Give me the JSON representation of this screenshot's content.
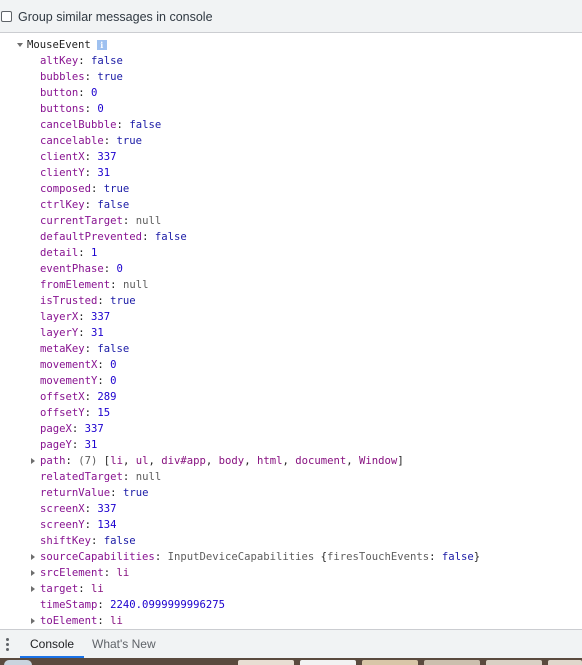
{
  "settings_bar": {
    "group_similar_label": "Group similar messages in console",
    "group_similar_checked": false
  },
  "console": {
    "object_name": "MouseEvent",
    "info_icon_glyph": "i",
    "properties": [
      {
        "key": "altKey",
        "value": "false",
        "kind": "bool",
        "expandable": false
      },
      {
        "key": "bubbles",
        "value": "true",
        "kind": "bool",
        "expandable": false
      },
      {
        "key": "button",
        "value": "0",
        "kind": "num",
        "expandable": false
      },
      {
        "key": "buttons",
        "value": "0",
        "kind": "num",
        "expandable": false
      },
      {
        "key": "cancelBubble",
        "value": "false",
        "kind": "bool",
        "expandable": false
      },
      {
        "key": "cancelable",
        "value": "true",
        "kind": "bool",
        "expandable": false
      },
      {
        "key": "clientX",
        "value": "337",
        "kind": "num",
        "expandable": false
      },
      {
        "key": "clientY",
        "value": "31",
        "kind": "num",
        "expandable": false
      },
      {
        "key": "composed",
        "value": "true",
        "kind": "bool",
        "expandable": false
      },
      {
        "key": "ctrlKey",
        "value": "false",
        "kind": "bool",
        "expandable": false
      },
      {
        "key": "currentTarget",
        "value": "null",
        "kind": "null",
        "expandable": false
      },
      {
        "key": "defaultPrevented",
        "value": "false",
        "kind": "bool",
        "expandable": false
      },
      {
        "key": "detail",
        "value": "1",
        "kind": "num",
        "expandable": false
      },
      {
        "key": "eventPhase",
        "value": "0",
        "kind": "num",
        "expandable": false
      },
      {
        "key": "fromElement",
        "value": "null",
        "kind": "null",
        "expandable": false
      },
      {
        "key": "isTrusted",
        "value": "true",
        "kind": "bool",
        "expandable": false
      },
      {
        "key": "layerX",
        "value": "337",
        "kind": "num",
        "expandable": false
      },
      {
        "key": "layerY",
        "value": "31",
        "kind": "num",
        "expandable": false
      },
      {
        "key": "metaKey",
        "value": "false",
        "kind": "bool",
        "expandable": false
      },
      {
        "key": "movementX",
        "value": "0",
        "kind": "num",
        "expandable": false
      },
      {
        "key": "movementY",
        "value": "0",
        "kind": "num",
        "expandable": false
      },
      {
        "key": "offsetX",
        "value": "289",
        "kind": "num",
        "expandable": false
      },
      {
        "key": "offsetY",
        "value": "15",
        "kind": "num",
        "expandable": false
      },
      {
        "key": "pageX",
        "value": "337",
        "kind": "num",
        "expandable": false
      },
      {
        "key": "pageY",
        "value": "31",
        "kind": "num",
        "expandable": false
      },
      {
        "key": "path",
        "kind": "path",
        "expandable": true,
        "count": "(7)",
        "items": [
          "li",
          "ul",
          "div#app",
          "body",
          "html",
          "document",
          "Window"
        ]
      },
      {
        "key": "relatedTarget",
        "value": "null",
        "kind": "null",
        "expandable": false
      },
      {
        "key": "returnValue",
        "value": "true",
        "kind": "bool",
        "expandable": false
      },
      {
        "key": "screenX",
        "value": "337",
        "kind": "num",
        "expandable": false
      },
      {
        "key": "screenY",
        "value": "134",
        "kind": "num",
        "expandable": false
      },
      {
        "key": "shiftKey",
        "value": "false",
        "kind": "bool",
        "expandable": false
      },
      {
        "key": "sourceCapabilities",
        "kind": "obj",
        "expandable": true,
        "class_name": "InputDeviceCapabilities",
        "preview_key": "firesTouchEvents",
        "preview_value": "false"
      },
      {
        "key": "srcElement",
        "value": "li",
        "kind": "tag",
        "expandable": true
      },
      {
        "key": "target",
        "value": "li",
        "kind": "tag",
        "expandable": true
      },
      {
        "key": "timeStamp",
        "value": "2240.0999999996275",
        "kind": "num",
        "expandable": false
      },
      {
        "key": "toElement",
        "value": "li",
        "kind": "tag",
        "expandable": true
      }
    ]
  },
  "bottom_bar": {
    "tabs": [
      {
        "label": "Console",
        "active": true
      },
      {
        "label": "What's New",
        "active": false
      }
    ]
  },
  "colors": {
    "property_key": "#881391",
    "number": "#1c00cf",
    "boolean": "#1a1aa6",
    "null": "#5e5e5e",
    "active_tab_underline": "#1a73e8",
    "toolbar_bg": "#f1f3f4"
  }
}
